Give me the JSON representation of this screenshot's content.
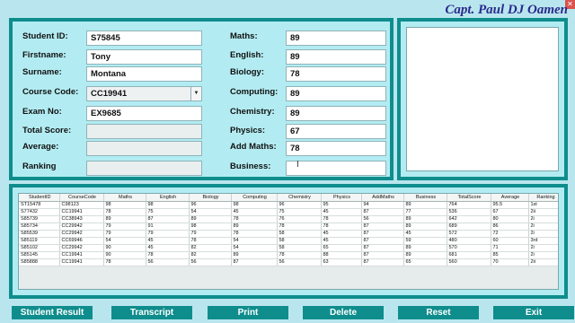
{
  "header": {
    "title": "Capt. Paul DJ Oamen"
  },
  "form": {
    "student_id": {
      "label": "Student ID:",
      "value": "S75845"
    },
    "firstname": {
      "label": "Firstname:",
      "value": "Tony"
    },
    "surname": {
      "label": "Surname:",
      "value": "Montana"
    },
    "course_code": {
      "label": "Course Code:",
      "value": "CC19941"
    },
    "exam_no": {
      "label": "Exam No:",
      "value": "EX9685"
    },
    "total_score": {
      "label": "Total Score:",
      "value": ""
    },
    "average": {
      "label": "Average:",
      "value": ""
    },
    "ranking": {
      "label": "Ranking",
      "value": ""
    },
    "maths": {
      "label": "Maths:",
      "value": "89"
    },
    "english": {
      "label": "English:",
      "value": "89"
    },
    "biology": {
      "label": "Biology:",
      "value": "78"
    },
    "computing": {
      "label": "Computing:",
      "value": "89"
    },
    "chemistry": {
      "label": "Chemistry:",
      "value": "89"
    },
    "physics": {
      "label": "Physics:",
      "value": "67"
    },
    "add_maths": {
      "label": "Add Maths:",
      "value": "78"
    },
    "business": {
      "label": "Business:",
      "value": ""
    }
  },
  "table": {
    "columns": [
      "StudentID",
      "CourseCode",
      "Maths",
      "English",
      "Biology",
      "Computing",
      "Chemistry",
      "Physics",
      "AddMaths",
      "Business",
      "TotalScore",
      "Average",
      "Ranking"
    ],
    "rows": [
      [
        "ST15478",
        "C98123",
        "98",
        "98",
        "96",
        "98",
        "96",
        "95",
        "94",
        "89",
        "764",
        "95.5",
        "1st"
      ],
      [
        "S77432",
        "CC19941",
        "78",
        "75",
        "54",
        "45",
        "75",
        "45",
        "87",
        "77",
        "536",
        "67",
        "2ii"
      ],
      [
        "S85739",
        "CC38943",
        "89",
        "87",
        "89",
        "78",
        "76",
        "78",
        "56",
        "89",
        "642",
        "80",
        "2i"
      ],
      [
        "S85734",
        "CC29942",
        "79",
        "91",
        "98",
        "89",
        "78",
        "78",
        "87",
        "89",
        "689",
        "86",
        "2i"
      ],
      [
        "S85539",
        "CC29942",
        "79",
        "79",
        "79",
        "78",
        "58",
        "45",
        "87",
        "45",
        "572",
        "72",
        "2i"
      ],
      [
        "S85119",
        "CC69946",
        "54",
        "45",
        "78",
        "54",
        "58",
        "45",
        "87",
        "59",
        "480",
        "60",
        "3rd"
      ],
      [
        "S85102",
        "CC29942",
        "90",
        "45",
        "82",
        "54",
        "58",
        "65",
        "87",
        "89",
        "570",
        "71",
        "2i"
      ],
      [
        "S85145",
        "CC19941",
        "90",
        "78",
        "82",
        "89",
        "78",
        "88",
        "87",
        "89",
        "681",
        "85",
        "2i"
      ],
      [
        "S85888",
        "CC19941",
        "78",
        "56",
        "56",
        "87",
        "56",
        "63",
        "87",
        "65",
        "560",
        "70",
        "2ii"
      ]
    ]
  },
  "buttons": {
    "student_result": "Student Result",
    "transcript": "Transcript",
    "print": "Print",
    "delete": "Delete",
    "reset": "Reset",
    "exit": "Exit"
  }
}
